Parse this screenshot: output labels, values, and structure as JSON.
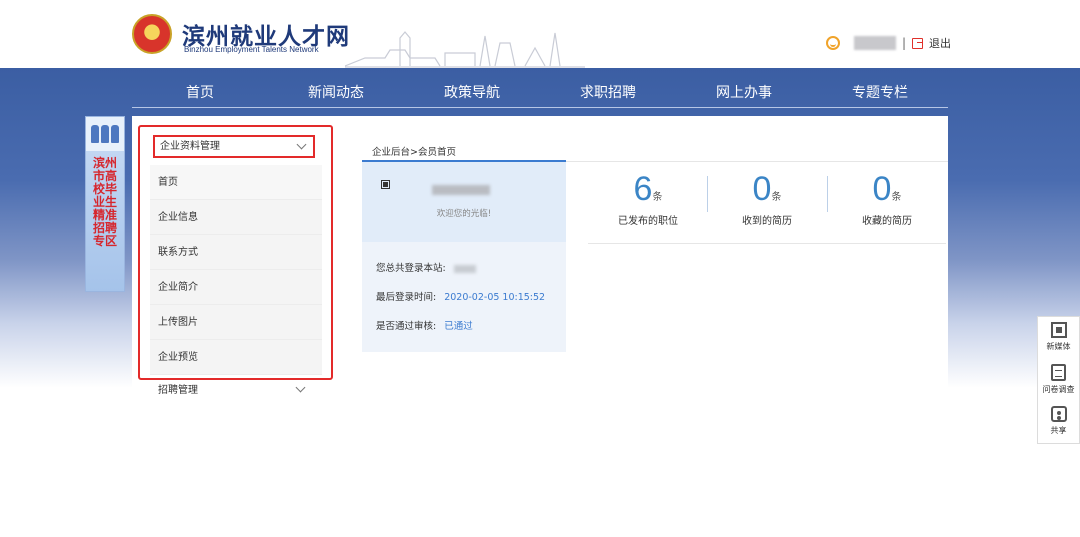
{
  "site": {
    "title": "滨州就业人才网",
    "subtitle": "Binzhou Employment Talents Network"
  },
  "user": {
    "separator": "|",
    "logout": "退出"
  },
  "nav": [
    "首页",
    "新闻动态",
    "政策导航",
    "求职招聘",
    "网上办事",
    "专题专栏"
  ],
  "left_banner": {
    "text": "滨州市高校毕业生精准招聘专区"
  },
  "sidebar": {
    "dropdown": "企业资料管理",
    "items": [
      "首页",
      "企业信息",
      "联系方式",
      "企业简介",
      "上传图片",
      "企业预览"
    ],
    "recruit": "招聘管理"
  },
  "breadcrumb": "企业后台>会员首页",
  "profile": {
    "welcome": "欢迎您的光临!",
    "login_count_label": "您总共登录本站:",
    "last_login_label": "最后登录时间:",
    "last_login_value": "2020-02-05 10:15:52",
    "approved_label": "是否通过审核:",
    "approved_value": "已通过"
  },
  "stats": [
    {
      "value": "6",
      "unit": "条",
      "label": "已发布的职位"
    },
    {
      "value": "0",
      "unit": "条",
      "label": "收到的简历"
    },
    {
      "value": "0",
      "unit": "条",
      "label": "收藏的简历"
    }
  ],
  "tools": [
    "新媒体",
    "问卷调查",
    "共享"
  ]
}
